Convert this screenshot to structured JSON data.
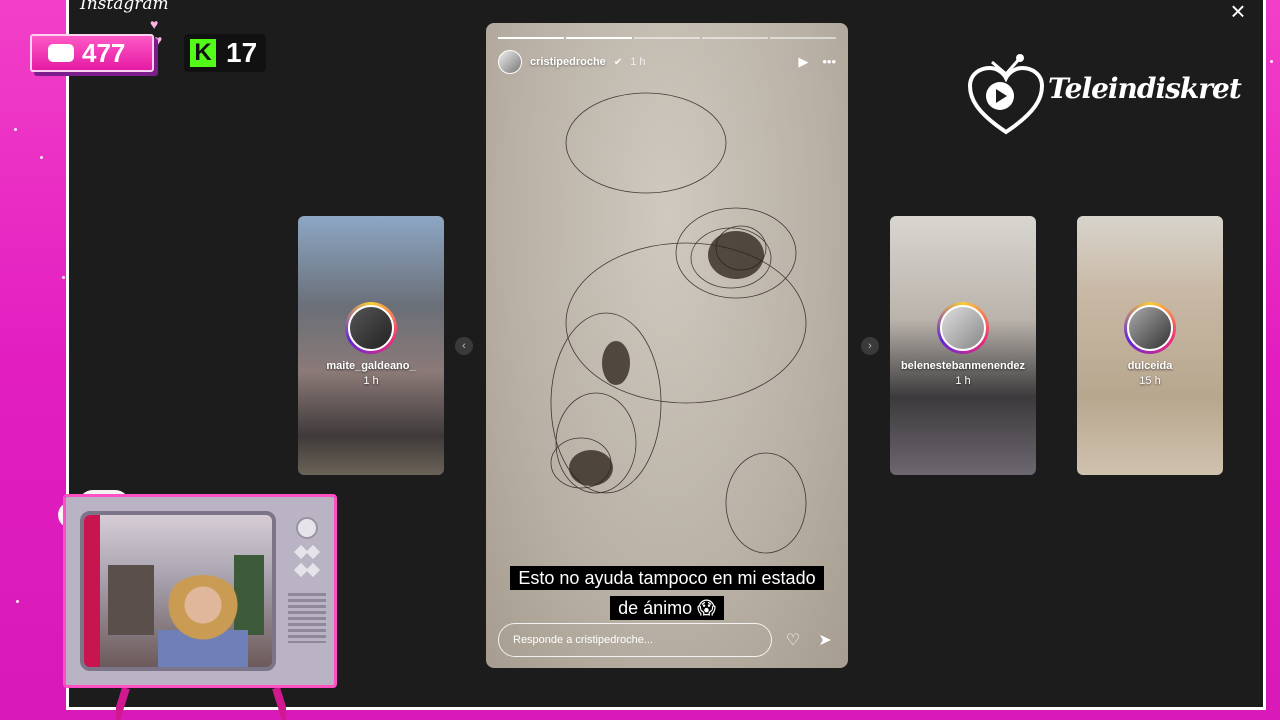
{
  "app": {
    "logo_text": "Instagram",
    "brand_name": "Teleindiskret"
  },
  "counters": {
    "youtube": "477",
    "kick_letter": "K",
    "kick": "17"
  },
  "story": {
    "user": "cristipedroche",
    "time": "1 h",
    "caption_line1": "Esto no ayuda tampoco en mi estado",
    "caption_line2": "de ánimo 😱",
    "reply_placeholder": "Responde a cristipedroche...",
    "segments_total": 5,
    "segments_done": 2
  },
  "side_stories": [
    {
      "user": "maite_galdeano_",
      "time": "1 h"
    },
    {
      "user": "belenestebanmenendez",
      "time": "1 h"
    },
    {
      "user": "dulceida",
      "time": "15 h"
    }
  ],
  "icons": {
    "close": "close-icon",
    "play": "play-icon",
    "more": "more-icon",
    "like": "heart-icon",
    "share": "send-icon",
    "prev": "chevron-left-icon",
    "next": "chevron-right-icon"
  },
  "colors": {
    "background": "#e21ec0",
    "frame": "#1c1c1c",
    "kick": "#53fc18",
    "accent": "#ff4fc3"
  }
}
